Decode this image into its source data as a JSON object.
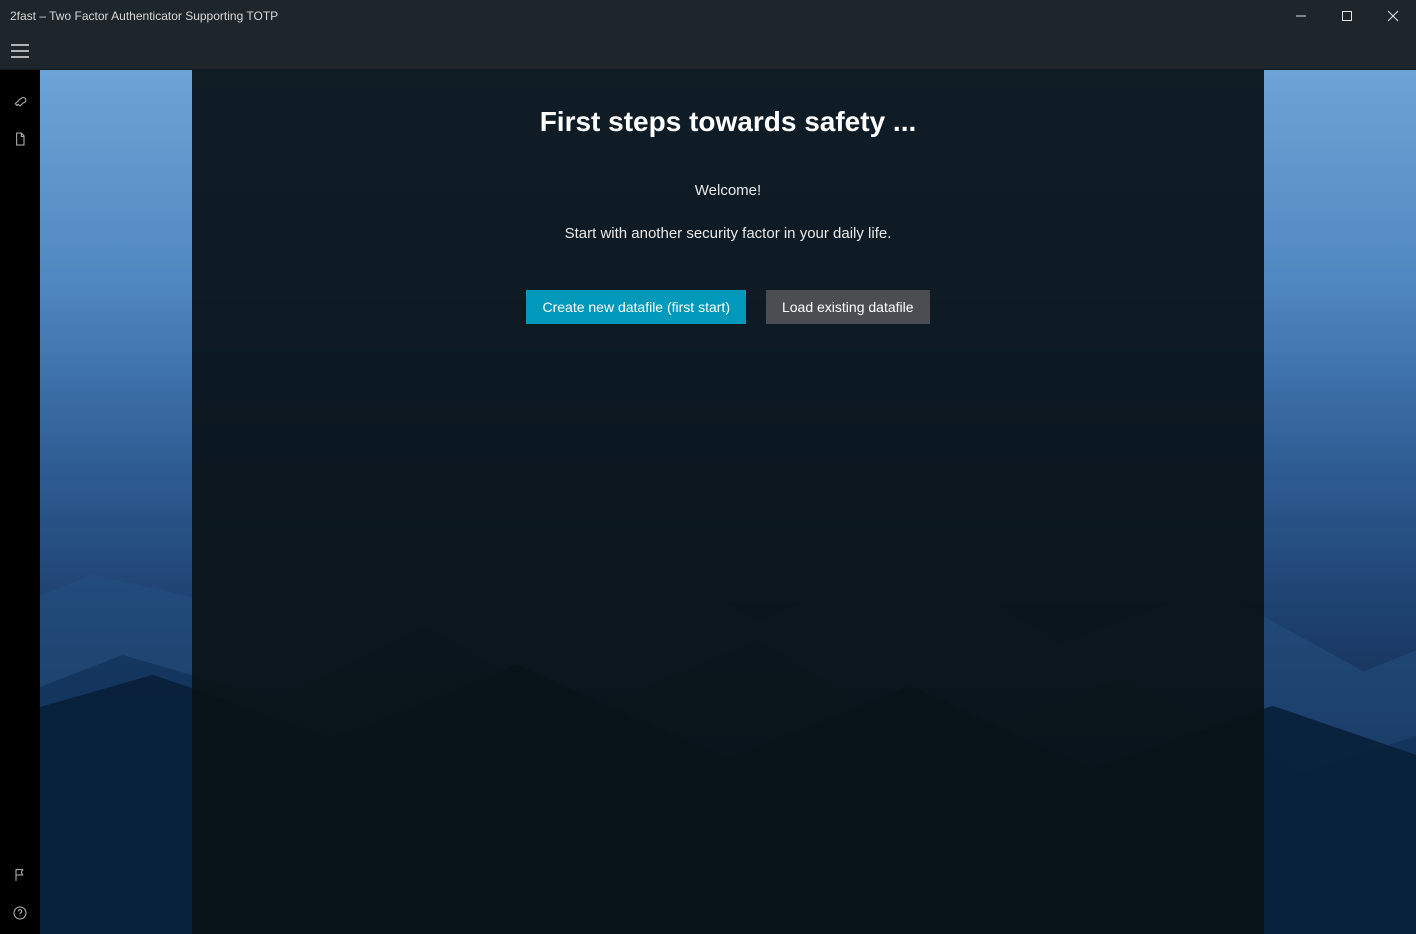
{
  "window": {
    "title": "2fast – Two Factor Authenticator Supporting TOTP"
  },
  "sidebar": {
    "items": [
      {
        "name": "key-icon"
      },
      {
        "name": "file-icon"
      }
    ],
    "bottom_items": [
      {
        "name": "flag-icon"
      },
      {
        "name": "help-icon"
      }
    ]
  },
  "main": {
    "heading": "First steps towards safety ...",
    "welcome": "Welcome!",
    "subline": "Start with another security factor in your daily life.",
    "buttons": {
      "create_label": "Create new datafile (first start)",
      "load_label": "Load existing datafile"
    }
  },
  "colors": {
    "accent": "#0099bc",
    "secondary_button": "#4a4e52",
    "panel_bg": "rgba(10,18,24,0.93)"
  }
}
